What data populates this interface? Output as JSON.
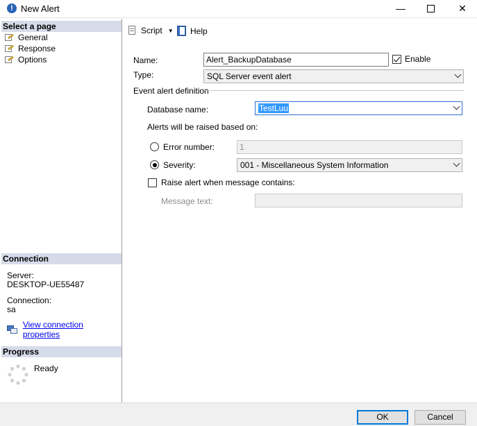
{
  "window": {
    "title": "New Alert",
    "app_icon": "info-icon"
  },
  "sidebar": {
    "select_page_header": "Select a page",
    "pages": [
      {
        "label": "General",
        "icon": "page-wrench-icon"
      },
      {
        "label": "Response",
        "icon": "page-wrench-icon"
      },
      {
        "label": "Options",
        "icon": "page-wrench-icon"
      }
    ],
    "connection_header": "Connection",
    "server_label": "Server:",
    "server_value": "DESKTOP-UE55487",
    "connection_label": "Connection:",
    "connection_value": "sa",
    "view_connection_link": "View connection properties",
    "progress_header": "Progress",
    "progress_status": "Ready"
  },
  "toolbar": {
    "script_label": "Script",
    "help_label": "Help"
  },
  "form": {
    "name_label": "Name:",
    "name_value": "Alert_BackupDatabase",
    "enable_label": "Enable",
    "enable_checked": true,
    "type_label": "Type:",
    "type_value": "SQL Server event alert",
    "event_section_label": "Event alert definition",
    "database_label": "Database name:",
    "database_value": "TestLuu",
    "alerts_raised_label": "Alerts will be raised based on:",
    "error_number_label": "Error number:",
    "error_number_value": "1",
    "severity_label": "Severity:",
    "severity_value": "001 - Miscellaneous System Information",
    "raise_alert_label": "Raise alert when message contains:",
    "raise_alert_checked": false,
    "message_text_label": "Message text:",
    "message_text_value": ""
  },
  "buttons": {
    "ok_label": "OK",
    "cancel_label": "Cancel"
  },
  "colors": {
    "sidebar_header_bg": "#d6dbe9",
    "link": "#0000ee",
    "focus_border": "#2e6dd0",
    "selection": "#3399ff",
    "default_button_border": "#0078d7"
  }
}
